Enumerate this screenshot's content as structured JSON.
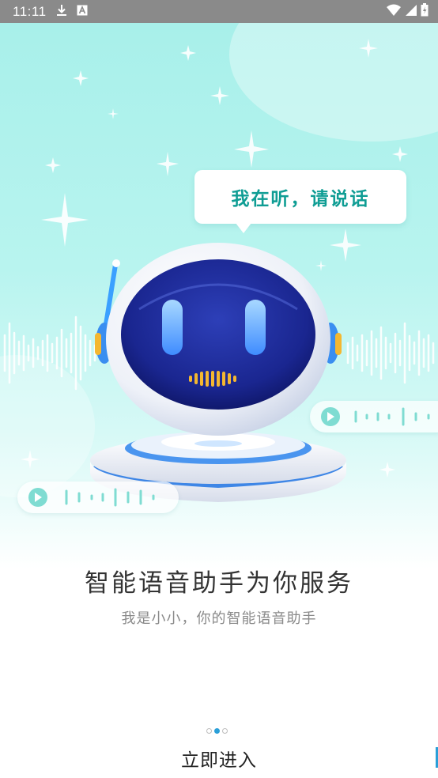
{
  "status_bar": {
    "time": "11:11",
    "icons": [
      "download-icon",
      "keyboard-a-icon",
      "wifi-icon",
      "signal-icon",
      "battery-charging-icon"
    ]
  },
  "speech_bubble": {
    "text": "我在听，请说话"
  },
  "robot": {
    "icon": "robot-assistant-icon"
  },
  "colors": {
    "accent": "#0f9d94",
    "dot_active": "#2a9fd8",
    "background_top": "#a8f0ea"
  },
  "onboarding": {
    "title": "智能语音助手为你服务",
    "subtitle": "我是小小，你的智能语音助手",
    "page_indicator": {
      "total": 3,
      "active": 2
    },
    "enter_button": "立即进入"
  }
}
